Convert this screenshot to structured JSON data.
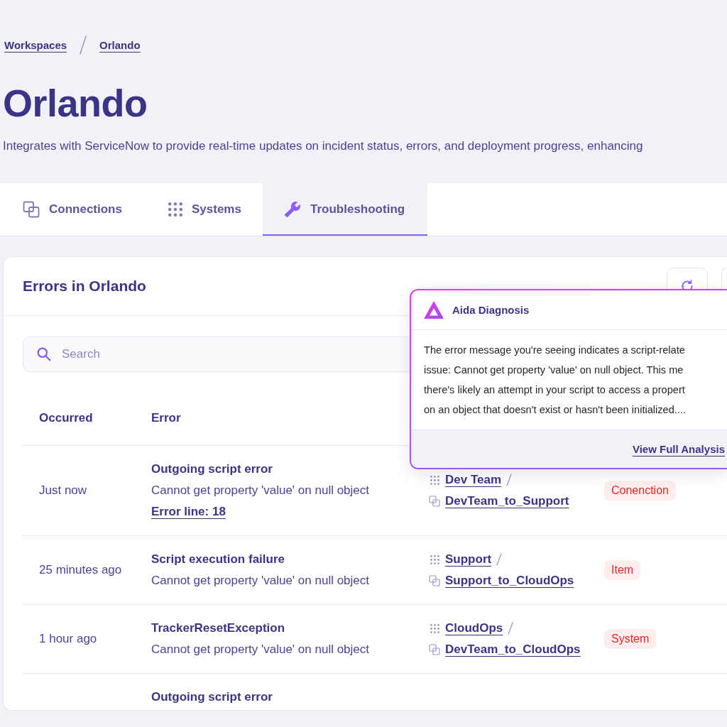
{
  "breadcrumb": [
    {
      "label": "Workspaces"
    },
    {
      "label": "Orlando"
    }
  ],
  "page": {
    "title": "Orlando",
    "description": "Integrates with ServiceNow to provide real-time updates on incident status, errors, and deployment progress, enhancing"
  },
  "tabs": [
    {
      "label": "Connections",
      "kind": "connections",
      "selected": false
    },
    {
      "label": "Systems",
      "kind": "systems",
      "selected": false
    },
    {
      "label": "Troubleshooting",
      "kind": "troubleshooting",
      "selected": true
    }
  ],
  "card": {
    "title": "Errors in Orlando",
    "search": {
      "placeholder": "Search"
    },
    "table": {
      "columns": [
        "Occurred",
        "Error"
      ],
      "rows": [
        {
          "occurred": "Just now",
          "error": {
            "title": "Outgoing script error",
            "message": "Cannot get property 'value' on null object",
            "link": "Error line: 18"
          },
          "column_3": {
            "system": "Dev Team",
            "connection": "DevTeam_to_Support"
          },
          "column_4": "Conenction"
        },
        {
          "occurred": "25 minutes ago",
          "error": {
            "title": "Script execution failure",
            "message": "Cannot get property 'value' on null object"
          },
          "column_3": {
            "system": "Support",
            "connection": "Support_to_CloudOps"
          },
          "column_4": "Item"
        },
        {
          "occurred": "1 hour ago",
          "error": {
            "title": "TrackerResetException",
            "message": "Cannot get property 'value' on null object"
          },
          "column_3": {
            "system": "CloudOps",
            "connection": "DevTeam_to_CloudOps"
          },
          "column_4": "System"
        },
        {
          "error": {
            "title": "Outgoing script error"
          }
        }
      ]
    }
  },
  "popup": {
    "title": "Aida Diagnosis",
    "body_lines": [
      "The error message you're seeing indicates a script-relate",
      "issue: Cannot get property 'value' on null object. This me",
      "there's likely an attempt in your script to access a propert",
      "on an object that doesn't exist or hasn't been initialized...."
    ],
    "link": "View Full Analysis"
  }
}
